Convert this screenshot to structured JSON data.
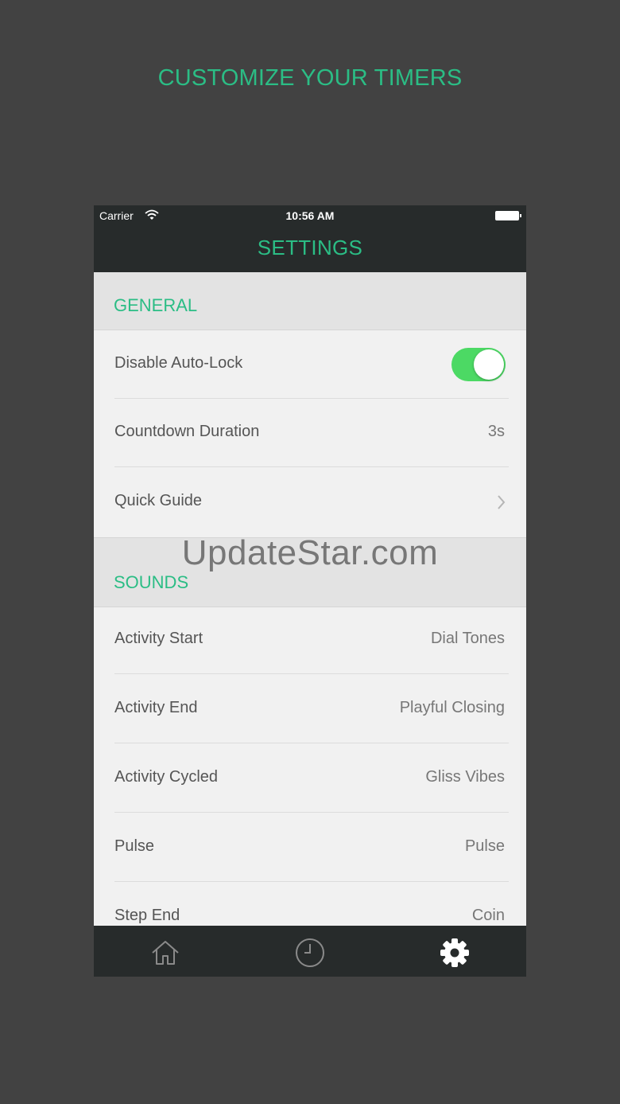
{
  "headline": "CUSTOMIZE YOUR TIMERS",
  "status_bar": {
    "carrier": "Carrier",
    "time": "10:56 AM"
  },
  "nav": {
    "title": "SETTINGS"
  },
  "general": {
    "header": "GENERAL",
    "disable_auto_lock": {
      "label": "Disable Auto-Lock",
      "on": true
    },
    "countdown_duration": {
      "label": "Countdown Duration",
      "value": "3s"
    },
    "quick_guide": {
      "label": "Quick Guide"
    }
  },
  "sounds": {
    "header": "SOUNDS",
    "rows": [
      {
        "label": "Activity Start",
        "value": "Dial Tones"
      },
      {
        "label": "Activity End",
        "value": "Playful Closing"
      },
      {
        "label": "Activity Cycled",
        "value": "Gliss Vibes"
      },
      {
        "label": "Pulse",
        "value": "Pulse"
      },
      {
        "label": "Step End",
        "value": "Coin"
      }
    ]
  },
  "watermark": "UpdateStar.com",
  "tabs": {
    "active": "settings"
  },
  "colors": {
    "accent": "#2bbd85",
    "toggle_on": "#4cd964",
    "bar_background": "#272b2b",
    "page_background": "#424242"
  }
}
